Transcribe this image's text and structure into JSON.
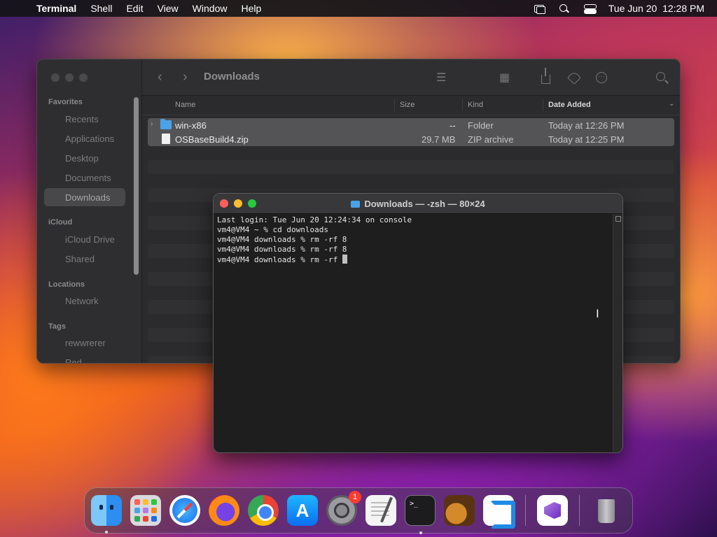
{
  "menubar": {
    "app_name": "Terminal",
    "items": [
      "Shell",
      "Edit",
      "View",
      "Window",
      "Help"
    ],
    "clock": "Tue Jun 20  12:28 PM"
  },
  "finder": {
    "title": "Downloads",
    "sidebar": {
      "favorites_label": "Favorites",
      "favorites": [
        "Recents",
        "Applications",
        "Desktop",
        "Documents",
        "Downloads"
      ],
      "icloud_label": "iCloud",
      "icloud": [
        "iCloud Drive",
        "Shared"
      ],
      "locations_label": "Locations",
      "locations": [
        "Network"
      ],
      "tags_label": "Tags",
      "tags": [
        "rewwrerer",
        "Red"
      ]
    },
    "columns": {
      "name": "Name",
      "size": "Size",
      "kind": "Kind",
      "date": "Date Added"
    },
    "files": [
      {
        "name": "win-x86",
        "size": "--",
        "kind": "Folder",
        "date": "Today at 12:26 PM"
      },
      {
        "name": "OSBaseBuild4.zip",
        "size": "29.7 MB",
        "kind": "ZIP archive",
        "date": "Today at 12:25 PM"
      }
    ]
  },
  "terminal": {
    "title": "Downloads — -zsh — 80×24",
    "lines": [
      "Last login: Tue Jun 20 12:24:34 on console",
      "vm4@VM4 ~ % cd downloads",
      "vm4@VM4 downloads % rm -rf 8",
      "vm4@VM4 downloads % rm -rf 8",
      "vm4@VM4 downloads % rm -rf "
    ]
  },
  "dock": {
    "badge_settings": "1",
    "terminal_icon_text": ">_",
    "appstore_glyph": "A"
  }
}
